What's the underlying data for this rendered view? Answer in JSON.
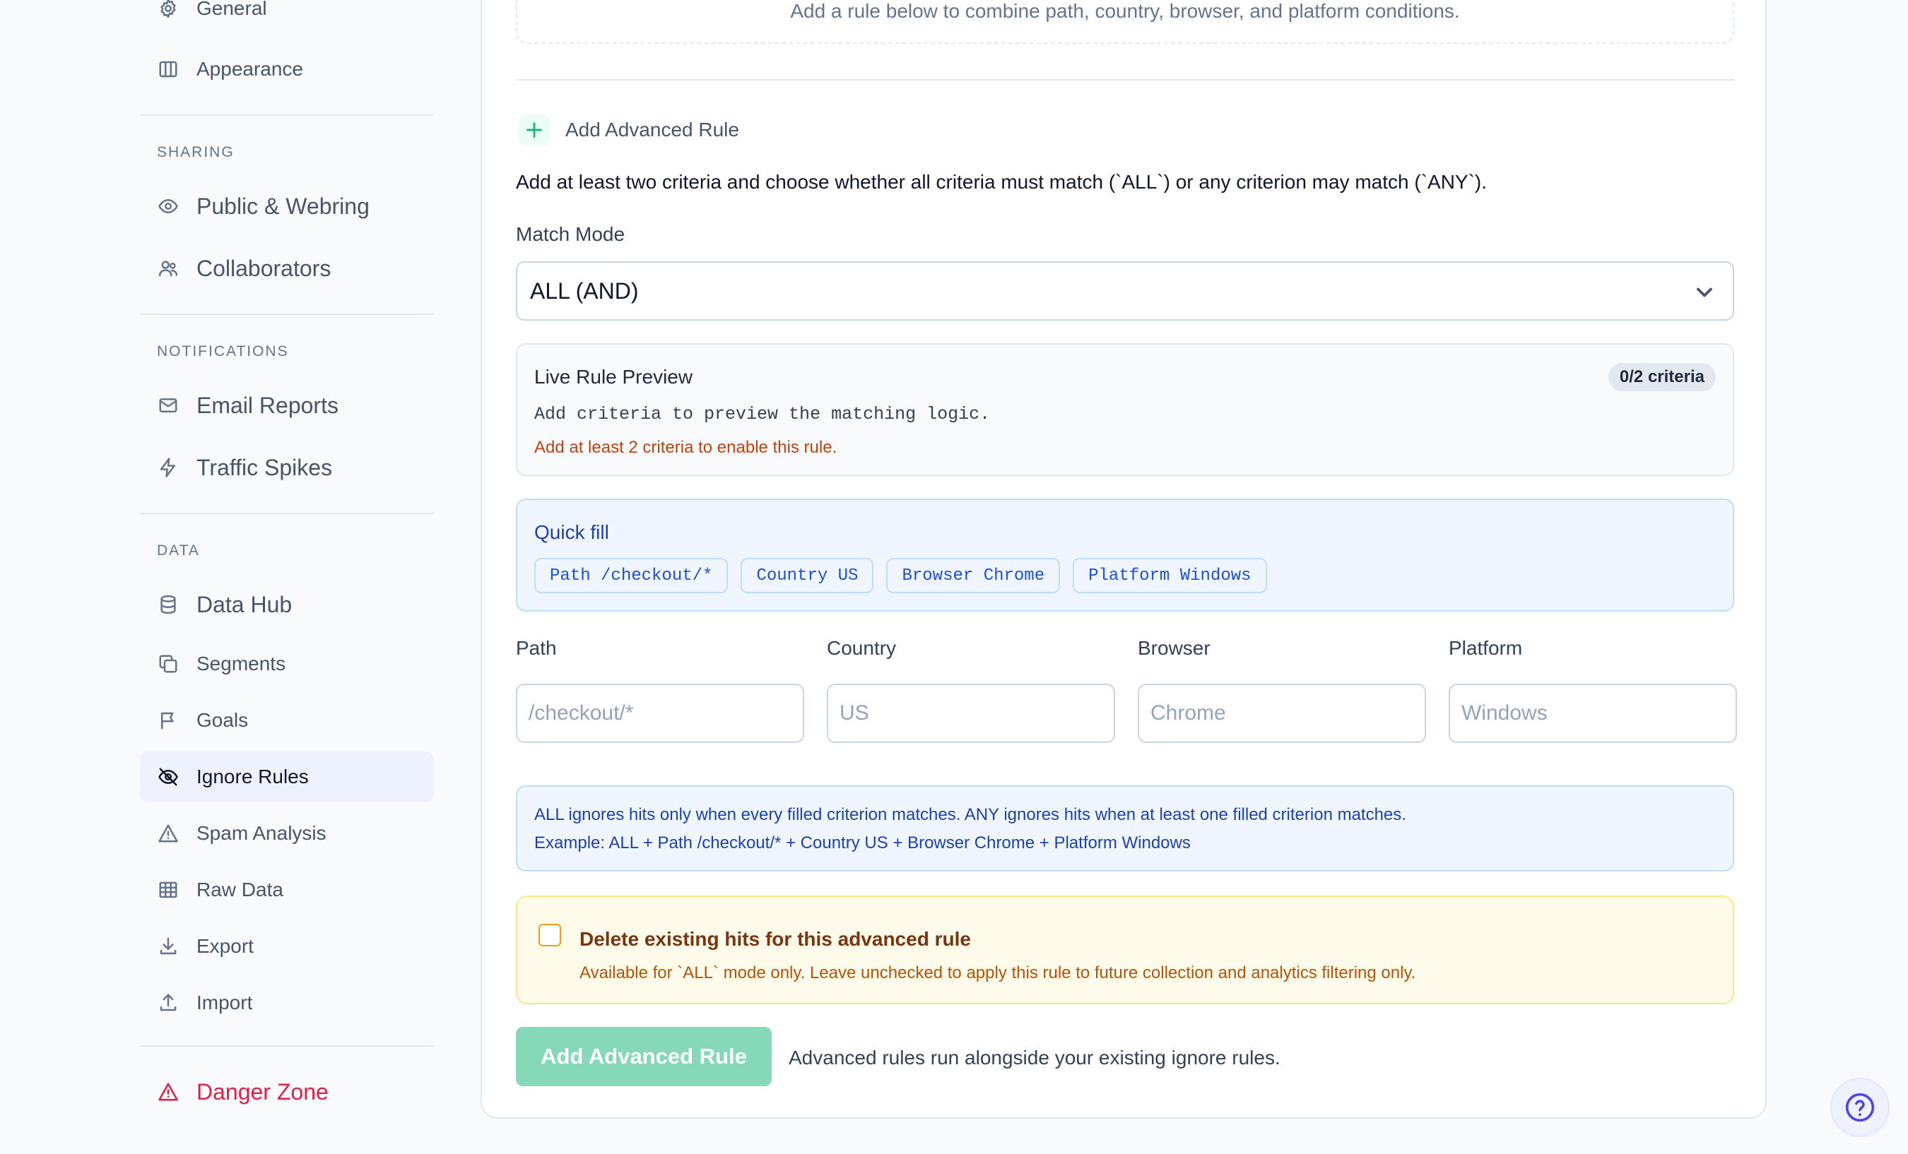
{
  "sidebar": {
    "items": [
      {
        "label": "General",
        "icon": "gear-icon"
      },
      {
        "label": "Appearance",
        "icon": "columns-icon"
      },
      {
        "label": "Public & Webring",
        "icon": "eye-icon"
      },
      {
        "label": "Collaborators",
        "icon": "users-icon"
      },
      {
        "label": "Email Reports",
        "icon": "mail-icon"
      },
      {
        "label": "Traffic Spikes",
        "icon": "bolt-icon"
      },
      {
        "label": "Data Hub",
        "icon": "database-icon"
      },
      {
        "label": "Segments",
        "icon": "copy-icon"
      },
      {
        "label": "Goals",
        "icon": "flag-icon"
      },
      {
        "label": "Ignore Rules",
        "icon": "eye-off-icon"
      },
      {
        "label": "Spam Analysis",
        "icon": "alert-triangle-icon"
      },
      {
        "label": "Raw Data",
        "icon": "table-icon"
      },
      {
        "label": "Export",
        "icon": "download-icon"
      },
      {
        "label": "Import",
        "icon": "upload-icon"
      },
      {
        "label": "Danger Zone",
        "icon": "danger-triangle-icon"
      }
    ],
    "sections": {
      "sharing": "SHARING",
      "notifications": "NOTIFICATIONS",
      "data": "DATA"
    },
    "active_item": "Ignore Rules"
  },
  "main": {
    "empty_state_text": "Add a rule below to combine path, country, browser, and platform conditions.",
    "advanced_heading": "Add Advanced Rule",
    "description": "Add at least two criteria and choose whether all criteria must match (`ALL`) or any criterion may match (`ANY`).",
    "match_mode": {
      "label": "Match Mode",
      "selected": "ALL (AND)"
    },
    "preview": {
      "title": "Live Rule Preview",
      "badge": "0/2 criteria",
      "code_text": "Add criteria to preview the matching logic.",
      "warning": "Add at least 2 criteria to enable this rule."
    },
    "quick_fill": {
      "title": "Quick fill",
      "chips": [
        "Path /checkout/*",
        "Country US",
        "Browser Chrome",
        "Platform Windows"
      ]
    },
    "fields": [
      {
        "label": "Path",
        "placeholder": "/checkout/*"
      },
      {
        "label": "Country",
        "placeholder": "US"
      },
      {
        "label": "Browser",
        "placeholder": "Chrome"
      },
      {
        "label": "Platform",
        "placeholder": "Windows"
      }
    ],
    "info": {
      "line1": "ALL ignores hits only when every filled criterion matches. ANY ignores hits when at least one filled criterion matches.",
      "line2": "Example: ALL + Path /checkout/* + Country US + Browser Chrome + Platform Windows"
    },
    "delete_option": {
      "title": "Delete existing hits for this advanced rule",
      "description": "Available for `ALL` mode only. Leave unchecked to apply this rule to future collection and analytics filtering only.",
      "checked": false
    },
    "submit_label": "Add Advanced Rule",
    "submit_note": "Advanced rules run alongside your existing ignore rules."
  },
  "colors": {
    "accent_green": "#10b981",
    "submit_disabled": "#86d9b8",
    "info_blue": "#1e40af",
    "warning_amber": "#b45309",
    "danger": "#e11d48"
  }
}
